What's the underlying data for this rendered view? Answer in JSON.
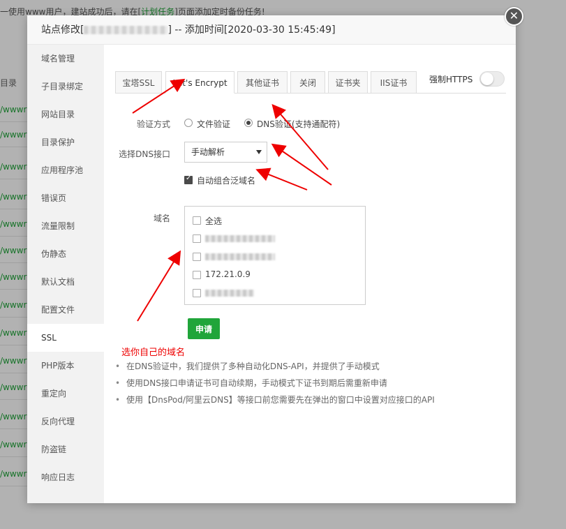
{
  "background": {
    "notice_pre": "一使用www用户，建站成功后，请在[",
    "notice_link": "计划任务",
    "notice_post": "]页面添加定时备份任务!",
    "column_header": "目录",
    "row_text": "/wwwr"
  },
  "dialog": {
    "title_prefix": "站点修改[",
    "title_suffix": "] -- 添加时间[2020-03-30 15:45:49]",
    "close_glyph": "✕"
  },
  "sidebar": {
    "items": [
      {
        "label": "域名管理"
      },
      {
        "label": "子目录绑定"
      },
      {
        "label": "网站目录"
      },
      {
        "label": "目录保护"
      },
      {
        "label": "应用程序池"
      },
      {
        "label": "错误页"
      },
      {
        "label": "流量限制"
      },
      {
        "label": "伪静态"
      },
      {
        "label": "默认文档"
      },
      {
        "label": "配置文件"
      },
      {
        "label": "SSL"
      },
      {
        "label": "PHP版本"
      },
      {
        "label": "重定向"
      },
      {
        "label": "反向代理"
      },
      {
        "label": "防盗链"
      },
      {
        "label": "响应日志"
      }
    ],
    "active_index": 10
  },
  "tabs": [
    {
      "label": "宝塔SSL"
    },
    {
      "label": "Let's Encrypt"
    },
    {
      "label": "其他证书"
    },
    {
      "label": "关闭"
    },
    {
      "label": "证书夹"
    },
    {
      "label": "IIS证书"
    }
  ],
  "active_tab": 1,
  "force_https": {
    "label": "强制HTTPS",
    "enabled": false
  },
  "form": {
    "verify_label": "验证方式",
    "verify_options": [
      {
        "label": "文件验证",
        "selected": false
      },
      {
        "label": "DNS验证(支持通配符)",
        "selected": true
      }
    ],
    "dns_label": "选择DNS接口",
    "dns_value": "手动解析",
    "wildcard_label": "自动组合泛域名",
    "wildcard_checked": true,
    "domain_label": "域名",
    "domains": [
      {
        "label": "全选",
        "checked": false
      },
      {
        "label": "",
        "checked": false
      },
      {
        "label": "",
        "checked": false
      },
      {
        "label": "172.21.0.9",
        "checked": false
      },
      {
        "label": "",
        "checked": false
      }
    ],
    "apply_label": "申请"
  },
  "annotation": "选你自己的域名",
  "tips": [
    "在DNS验证中，我们提供了多种自动化DNS-API，并提供了手动模式",
    "使用DNS接口申请证书可自动续期，手动模式下证书到期后需重新申请",
    "使用【DnsPod/阿里云DNS】等接口前您需要先在弹出的窗口中设置对应接口的API"
  ],
  "colors": {
    "accent": "#20a53a",
    "annotation": "#e00000"
  }
}
